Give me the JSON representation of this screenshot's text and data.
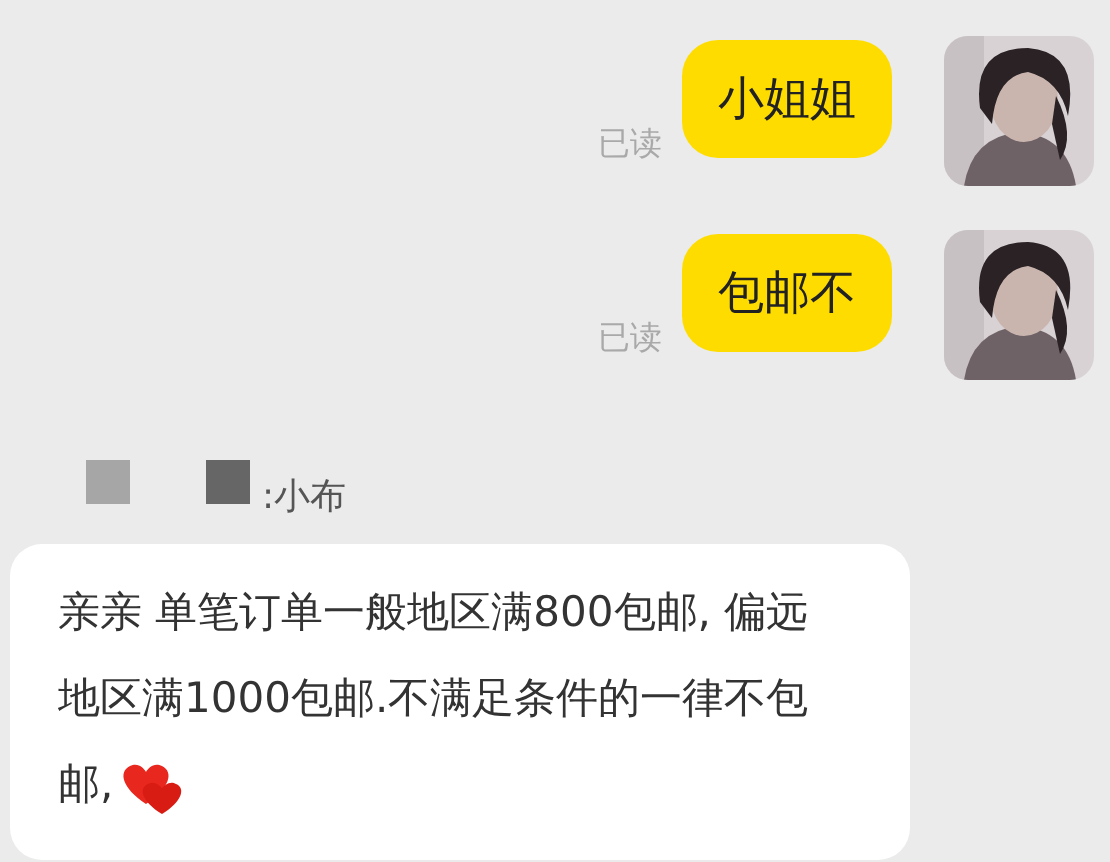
{
  "messages": [
    {
      "kind": "outgoing",
      "text": "小姐姐",
      "status": "已读"
    },
    {
      "kind": "outgoing",
      "text": "包邮不",
      "status": "已读"
    },
    {
      "kind": "sender",
      "text": ":小布"
    },
    {
      "kind": "incoming",
      "text": "亲亲 单笔订单一般地区满800包邮, 偏远地区满1000包邮.不满足条件的一律不包邮,",
      "sticker": {
        "kind": "hearts"
      }
    }
  ]
}
